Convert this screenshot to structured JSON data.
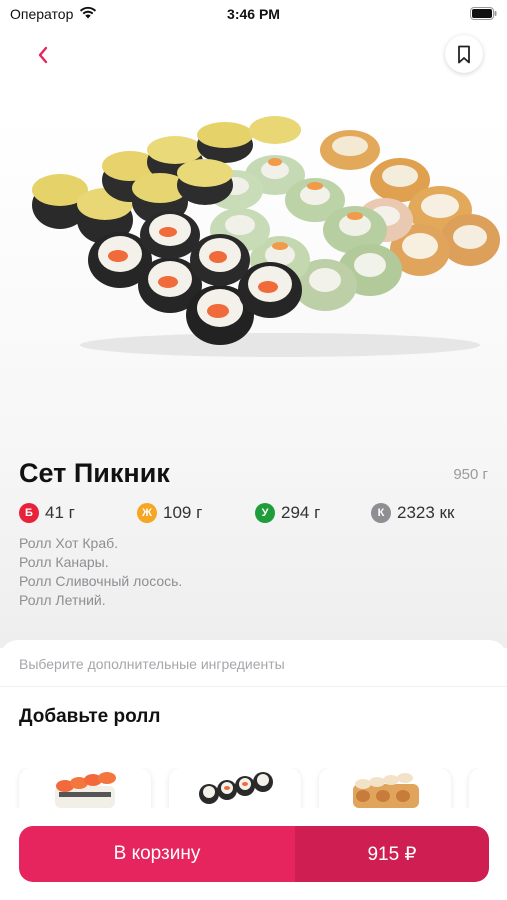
{
  "status_bar": {
    "carrier": "Оператор",
    "time": "3:46 PM"
  },
  "product": {
    "title": "Сет Пикник",
    "weight": "950 г",
    "nutrition": [
      {
        "letter": "Б",
        "value": "41 г",
        "color": "#e8223a"
      },
      {
        "letter": "Ж",
        "value": "109 г",
        "color": "#f5a623"
      },
      {
        "letter": "У",
        "value": "294 г",
        "color": "#1f9d3a"
      },
      {
        "letter": "К",
        "value": "2323 кк",
        "color": "#8e8e93"
      }
    ],
    "description": [
      "Ролл Хот Краб.",
      "Ролл Канары.",
      "Ролл Сливочный лосось.",
      "Ролл Летний."
    ]
  },
  "extras": {
    "hint": "Выберите дополнительные ингредиенты",
    "add_roll_title": "Добавьте ролл"
  },
  "cart": {
    "label": "В корзину",
    "price": "915 ₽"
  },
  "colors": {
    "accent": "#e6255e",
    "accent_dark": "#cf1e52"
  },
  "icons": {
    "back": "chevron-left-icon",
    "bookmark": "bookmark-icon",
    "wifi": "wifi-icon",
    "battery": "battery-icon"
  }
}
